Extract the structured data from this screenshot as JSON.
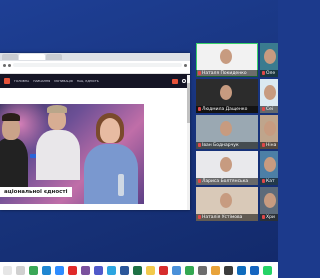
{
  "browser": {
    "site_nav": [
      "ГОЛОВНА",
      "НАВЧАННЯ",
      "МОТИВАЦІЯ",
      "НАЦ. ЄДНІСТЬ"
    ],
    "banner_text": "аціональної єдності"
  },
  "participants": [
    {
      "name": "Наталя Покиденко",
      "bg": "#f2f2f2",
      "active": true
    },
    {
      "name": "Оле",
      "bg": "#3a7b8f"
    },
    {
      "name": "Людмила Дащенко",
      "bg": "#2c2c2c"
    },
    {
      "name": "Сеі",
      "bg": "#dbe9f1"
    },
    {
      "name": "Іван Боднарчук",
      "bg": "#9aa8b2"
    },
    {
      "name": "Ніна",
      "bg": "#bfa58c"
    },
    {
      "name": "Лариса Болтянська",
      "bg": "#e9e9ec"
    },
    {
      "name": "Кат",
      "bg": "#4c7fa6"
    },
    {
      "name": "Наталія Устімова",
      "bg": "#d9c9b8"
    },
    {
      "name": "Хри",
      "bg": "#5d6b7a"
    }
  ],
  "taskbar_icons": [
    {
      "name": "start-icon",
      "color": "#e6e6e6"
    },
    {
      "name": "search-icon",
      "color": "#d0d0d0"
    },
    {
      "name": "chrome-icon",
      "color": "#3aa757"
    },
    {
      "name": "edge-icon",
      "color": "#1f86d1"
    },
    {
      "name": "zoom-icon",
      "color": "#2d8cff"
    },
    {
      "name": "opera-icon",
      "color": "#e02a2a"
    },
    {
      "name": "viber-icon",
      "color": "#7b519d"
    },
    {
      "name": "teams-icon",
      "color": "#5059c9"
    },
    {
      "name": "telegram-icon",
      "color": "#2ca5e0"
    },
    {
      "name": "word-icon",
      "color": "#2b579a"
    },
    {
      "name": "excel-icon",
      "color": "#1e7145"
    },
    {
      "name": "folder-icon",
      "color": "#f2c94c"
    },
    {
      "name": "video-icon",
      "color": "#d62d2d"
    },
    {
      "name": "photos-icon",
      "color": "#4a90d9"
    },
    {
      "name": "maps-icon",
      "color": "#33a852"
    },
    {
      "name": "settings-icon",
      "color": "#6d6d6d"
    },
    {
      "name": "app-icon",
      "color": "#e8a33a"
    },
    {
      "name": "calc-icon",
      "color": "#3c3c3c"
    },
    {
      "name": "store-icon",
      "color": "#0f6cbd"
    },
    {
      "name": "mail-icon",
      "color": "#1565c0"
    },
    {
      "name": "chat-icon",
      "color": "#25d366"
    }
  ]
}
